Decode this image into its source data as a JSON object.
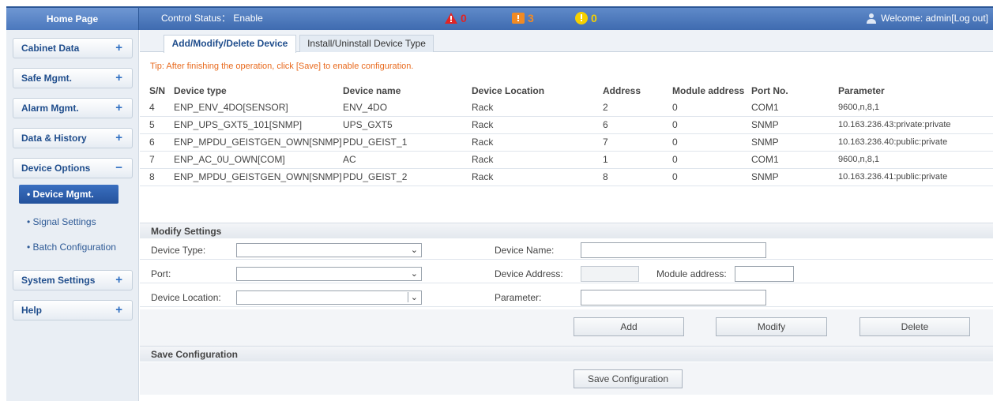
{
  "header": {
    "home_label": "Home Page",
    "control_status": "Control Status： Enable",
    "alarms": [
      {
        "icon": "critical-alarm-icon",
        "count": "0",
        "color": "#e02424"
      },
      {
        "icon": "major-alarm-icon",
        "count": "3",
        "color": "#f08a24"
      },
      {
        "icon": "minor-alarm-icon",
        "count": "0",
        "color": "#f5d000"
      }
    ],
    "welcome": "Welcome: admin[Log out]"
  },
  "sidebar": {
    "items": [
      {
        "label": "Cabinet Data",
        "sign": "+"
      },
      {
        "label": "Safe Mgmt.",
        "sign": "+"
      },
      {
        "label": "Alarm Mgmt.",
        "sign": "+"
      },
      {
        "label": "Data & History",
        "sign": "+"
      },
      {
        "label": "Device Options",
        "sign": "−"
      },
      {
        "label": "System Settings",
        "sign": "+"
      },
      {
        "label": "Help",
        "sign": "+"
      }
    ],
    "subitems": [
      {
        "label": "• Device Mgmt."
      },
      {
        "label": "• Signal Settings"
      },
      {
        "label": "• Batch Configuration"
      }
    ]
  },
  "tabs": [
    {
      "label": "Add/Modify/Delete Device"
    },
    {
      "label": "Install/Uninstall Device Type"
    }
  ],
  "tip": "Tip: After finishing the operation, click [Save] to enable configuration.",
  "table": {
    "headers": [
      "S/N",
      "Device type",
      "Device name",
      "Device Location",
      "Address",
      "Module address",
      "Port No.",
      "Parameter"
    ],
    "rows": [
      [
        "4",
        "ENP_ENV_4DO[SENSOR]",
        "ENV_4DO",
        "Rack",
        "2",
        "0",
        "COM1",
        "9600,n,8,1"
      ],
      [
        "5",
        "ENP_UPS_GXT5_101[SNMP]",
        "UPS_GXT5",
        "Rack",
        "6",
        "0",
        "SNMP",
        "10.163.236.43:private:private"
      ],
      [
        "6",
        "ENP_MPDU_GEISTGEN_OWN[SNMP]",
        "PDU_GEIST_1",
        "Rack",
        "7",
        "0",
        "SNMP",
        "10.163.236.40:public:private"
      ],
      [
        "7",
        "ENP_AC_0U_OWN[COM]",
        "AC",
        "Rack",
        "1",
        "0",
        "COM1",
        "9600,n,8,1"
      ],
      [
        "8",
        "ENP_MPDU_GEISTGEN_OWN[SNMP]",
        "PDU_GEIST_2",
        "Rack",
        "8",
        "0",
        "SNMP",
        "10.163.236.41:public:private"
      ]
    ]
  },
  "modify": {
    "title": "Modify Settings",
    "device_type_label": "Device Type:",
    "port_label": "Port:",
    "location_label": "Device Location:",
    "device_name_label": "Device Name:",
    "device_address_label": "Device Address:",
    "module_address_label": "Module address:",
    "parameter_label": "Parameter:",
    "add_label": "Add",
    "modify_label": "Modify",
    "delete_label": "Delete"
  },
  "save": {
    "title": "Save Configuration",
    "button_label": "Save Configuration"
  }
}
